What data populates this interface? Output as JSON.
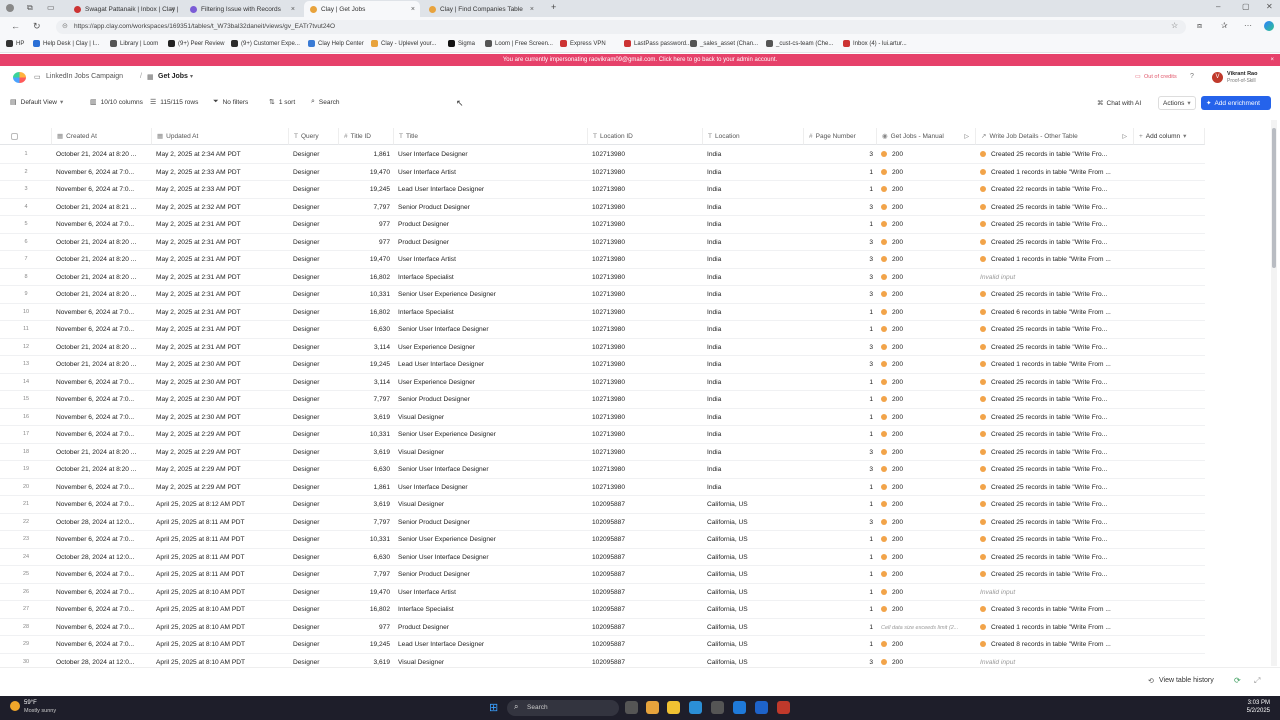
{
  "browser": {
    "tabs": [
      {
        "label": "Swagat Pattanaik | Inbox | Clay | I...",
        "color": "#c33"
      },
      {
        "label": "Filtering Issue with Records",
        "color": "#7b5cd6"
      },
      {
        "label": "Clay | Get Jobs",
        "color": "#e8a33d"
      },
      {
        "label": "Clay | Find Companies Table",
        "color": "#e8a33d"
      }
    ],
    "new_tab": "+",
    "url": "https://app.clay.com/workspaces/169351/tables/t_W73bal32daneit/views/gv_EATr7tvut24O",
    "bookmarks": [
      "HP",
      "Help Desk | Clay | I...",
      "Library | Loom",
      "(9+) Peer Review",
      "(9+) Customer Expe...",
      "Clay Help Center",
      "Clay - Uplevel your...",
      "Sigma",
      "Loom | Free Screen...",
      "Express VPN",
      "LastPass password...",
      "_sales_asset (Chan...",
      "_cust-cs-team (Che...",
      "Inbox (4) - lui.artur..."
    ]
  },
  "banner": {
    "text": "You are currently impersonating raovikram09@gmail.com. Click here to go back to your admin account.",
    "close": "×"
  },
  "app": {
    "breadcrumb_parent": "LinkedIn Jobs Campaign",
    "breadcrumb_sep": "/",
    "breadcrumb_current": "Get Jobs",
    "credits": "Out of credits",
    "user_name": "Vikrant Rao",
    "user_sub": "Proof-of-Skill",
    "user_initial": "V"
  },
  "toolbar": {
    "view": "Default View",
    "columns": "10/10 columns",
    "rows": "115/115 rows",
    "filters": "No filters",
    "sort": "1 sort",
    "search": "Search",
    "chat": "Chat with AI",
    "actions": "Actions",
    "add_enrichment": "Add enrichment"
  },
  "table": {
    "headers": [
      "Created At",
      "Updated At",
      "Query",
      "Title ID",
      "Title",
      "Location ID",
      "Location",
      "Page Number",
      "Get Jobs - Manual",
      "Write Job Details - Other Table"
    ],
    "add_column": "Add column",
    "rows": [
      [
        "1",
        "October 21, 2024 at 8:20 ...",
        "May 2, 2025 at 2:34 AM PDT",
        "Designer",
        "1,861",
        "User Interface Designer",
        "102713980",
        "India",
        "3",
        "200",
        "Created 25 records in table \"Write Fro..."
      ],
      [
        "2",
        "November 6, 2024 at 7:0...",
        "May 2, 2025 at 2:33 AM PDT",
        "Designer",
        "19,470",
        "User Interface Artist",
        "102713980",
        "India",
        "1",
        "200",
        "Created 1 records in table \"Write From ..."
      ],
      [
        "3",
        "November 6, 2024 at 7:0...",
        "May 2, 2025 at 2:33 AM PDT",
        "Designer",
        "19,245",
        "Lead User Interface Designer",
        "102713980",
        "India",
        "1",
        "200",
        "Created 22 records in table \"Write Fro..."
      ],
      [
        "4",
        "October 21, 2024 at 8:21 ...",
        "May 2, 2025 at 2:32 AM PDT",
        "Designer",
        "7,797",
        "Senior Product Designer",
        "102713980",
        "India",
        "3",
        "200",
        "Created 25 records in table \"Write Fro..."
      ],
      [
        "5",
        "November 6, 2024 at 7:0...",
        "May 2, 2025 at 2:31 AM PDT",
        "Designer",
        "977",
        "Product Designer",
        "102713980",
        "India",
        "1",
        "200",
        "Created 25 records in table \"Write Fro..."
      ],
      [
        "6",
        "October 21, 2024 at 8:20 ...",
        "May 2, 2025 at 2:31 AM PDT",
        "Designer",
        "977",
        "Product Designer",
        "102713980",
        "India",
        "3",
        "200",
        "Created 25 records in table \"Write Fro..."
      ],
      [
        "7",
        "October 21, 2024 at 8:20 ...",
        "May 2, 2025 at 2:31 AM PDT",
        "Designer",
        "19,470",
        "User Interface Artist",
        "102713980",
        "India",
        "3",
        "200",
        "Created 1 records in table \"Write From ..."
      ],
      [
        "8",
        "October 21, 2024 at 8:20 ...",
        "May 2, 2025 at 2:31 AM PDT",
        "Designer",
        "16,802",
        "Interface Specialist",
        "102713980",
        "India",
        "3",
        "200",
        "Invalid input"
      ],
      [
        "9",
        "October 21, 2024 at 8:20 ...",
        "May 2, 2025 at 2:31 AM PDT",
        "Designer",
        "10,331",
        "Senior User Experience Designer",
        "102713980",
        "India",
        "3",
        "200",
        "Created 25 records in table \"Write Fro..."
      ],
      [
        "10",
        "November 6, 2024 at 7:0...",
        "May 2, 2025 at 2:31 AM PDT",
        "Designer",
        "16,802",
        "Interface Specialist",
        "102713980",
        "India",
        "1",
        "200",
        "Created 6 records in table \"Write From ..."
      ],
      [
        "11",
        "November 6, 2024 at 7:0...",
        "May 2, 2025 at 2:31 AM PDT",
        "Designer",
        "6,630",
        "Senior User Interface Designer",
        "102713980",
        "India",
        "1",
        "200",
        "Created 25 records in table \"Write Fro..."
      ],
      [
        "12",
        "October 21, 2024 at 8:20 ...",
        "May 2, 2025 at 2:31 AM PDT",
        "Designer",
        "3,114",
        "User Experience Designer",
        "102713980",
        "India",
        "3",
        "200",
        "Created 25 records in table \"Write Fro..."
      ],
      [
        "13",
        "October 21, 2024 at 8:20 ...",
        "May 2, 2025 at 2:30 AM PDT",
        "Designer",
        "19,245",
        "Lead User Interface Designer",
        "102713980",
        "India",
        "3",
        "200",
        "Created 1 records in table \"Write From ..."
      ],
      [
        "14",
        "November 6, 2024 at 7:0...",
        "May 2, 2025 at 2:30 AM PDT",
        "Designer",
        "3,114",
        "User Experience Designer",
        "102713980",
        "India",
        "1",
        "200",
        "Created 25 records in table \"Write Fro..."
      ],
      [
        "15",
        "November 6, 2024 at 7:0...",
        "May 2, 2025 at 2:30 AM PDT",
        "Designer",
        "7,797",
        "Senior Product Designer",
        "102713980",
        "India",
        "1",
        "200",
        "Created 25 records in table \"Write Fro..."
      ],
      [
        "16",
        "November 6, 2024 at 7:0...",
        "May 2, 2025 at 2:30 AM PDT",
        "Designer",
        "3,619",
        "Visual Designer",
        "102713980",
        "India",
        "1",
        "200",
        "Created 25 records in table \"Write Fro..."
      ],
      [
        "17",
        "November 6, 2024 at 7:0...",
        "May 2, 2025 at 2:29 AM PDT",
        "Designer",
        "10,331",
        "Senior User Experience Designer",
        "102713980",
        "India",
        "1",
        "200",
        "Created 25 records in table \"Write Fro..."
      ],
      [
        "18",
        "October 21, 2024 at 8:20 ...",
        "May 2, 2025 at 2:29 AM PDT",
        "Designer",
        "3,619",
        "Visual Designer",
        "102713980",
        "India",
        "3",
        "200",
        "Created 25 records in table \"Write Fro..."
      ],
      [
        "19",
        "October 21, 2024 at 8:20 ...",
        "May 2, 2025 at 2:29 AM PDT",
        "Designer",
        "6,630",
        "Senior User Interface Designer",
        "102713980",
        "India",
        "3",
        "200",
        "Created 25 records in table \"Write Fro..."
      ],
      [
        "20",
        "November 6, 2024 at 7:0...",
        "May 2, 2025 at 2:29 AM PDT",
        "Designer",
        "1,861",
        "User Interface Designer",
        "102713980",
        "India",
        "1",
        "200",
        "Created 25 records in table \"Write Fro..."
      ],
      [
        "21",
        "November 6, 2024 at 7:0...",
        "April 25, 2025 at 8:12 AM PDT",
        "Designer",
        "3,619",
        "Visual Designer",
        "102095887",
        "California, US",
        "1",
        "200",
        "Created 25 records in table \"Write Fro..."
      ],
      [
        "22",
        "October 28, 2024 at 12:0...",
        "April 25, 2025 at 8:11 AM PDT",
        "Designer",
        "7,797",
        "Senior Product Designer",
        "102095887",
        "California, US",
        "3",
        "200",
        "Created 25 records in table \"Write Fro..."
      ],
      [
        "23",
        "November 6, 2024 at 7:0...",
        "April 25, 2025 at 8:11 AM PDT",
        "Designer",
        "10,331",
        "Senior User Experience Designer",
        "102095887",
        "California, US",
        "1",
        "200",
        "Created 25 records in table \"Write Fro..."
      ],
      [
        "24",
        "October 28, 2024 at 12:0...",
        "April 25, 2025 at 8:11 AM PDT",
        "Designer",
        "6,630",
        "Senior User Interface Designer",
        "102095887",
        "California, US",
        "1",
        "200",
        "Created 25 records in table \"Write Fro..."
      ],
      [
        "25",
        "November 6, 2024 at 7:0...",
        "April 25, 2025 at 8:11 AM PDT",
        "Designer",
        "7,797",
        "Senior Product Designer",
        "102095887",
        "California, US",
        "1",
        "200",
        "Created 25 records in table \"Write Fro..."
      ],
      [
        "26",
        "November 6, 2024 at 7:0...",
        "April 25, 2025 at 8:10 AM PDT",
        "Designer",
        "19,470",
        "User Interface Artist",
        "102095887",
        "California, US",
        "1",
        "200",
        "Invalid input"
      ],
      [
        "27",
        "November 6, 2024 at 7:0...",
        "April 25, 2025 at 8:10 AM PDT",
        "Designer",
        "16,802",
        "Interface Specialist",
        "102095887",
        "California, US",
        "1",
        "200",
        "Created 3 records in table \"Write From ..."
      ],
      [
        "28",
        "November 6, 2024 at 7:0...",
        "April 25, 2025 at 8:10 AM PDT",
        "Designer",
        "977",
        "Product Designer",
        "102095887",
        "California, US",
        "1",
        "Cell data size exceeds limit (2...",
        "Created 1 records in table \"Write From ..."
      ],
      [
        "29",
        "November 6, 2024 at 7:0...",
        "April 25, 2025 at 8:10 AM PDT",
        "Designer",
        "19,245",
        "Lead User Interface Designer",
        "102095887",
        "California, US",
        "1",
        "200",
        "Created 8 records in table \"Write From ..."
      ],
      [
        "30",
        "October 28, 2024 at 12:0...",
        "April 25, 2025 at 8:10 AM PDT",
        "Designer",
        "3,619",
        "Visual Designer",
        "102095887",
        "California, US",
        "3",
        "200",
        "Invalid input"
      ]
    ]
  },
  "footer": {
    "history": "View table history"
  },
  "taskbar": {
    "weather_temp": "59°F",
    "weather_desc": "Mostly sunny",
    "search": "Search",
    "time": "3:03 PM",
    "date": "5/2/2025"
  },
  "colors": {
    "accent": "#2563eb",
    "banner": "#e6416a",
    "status_dot": "#f2a44a"
  }
}
